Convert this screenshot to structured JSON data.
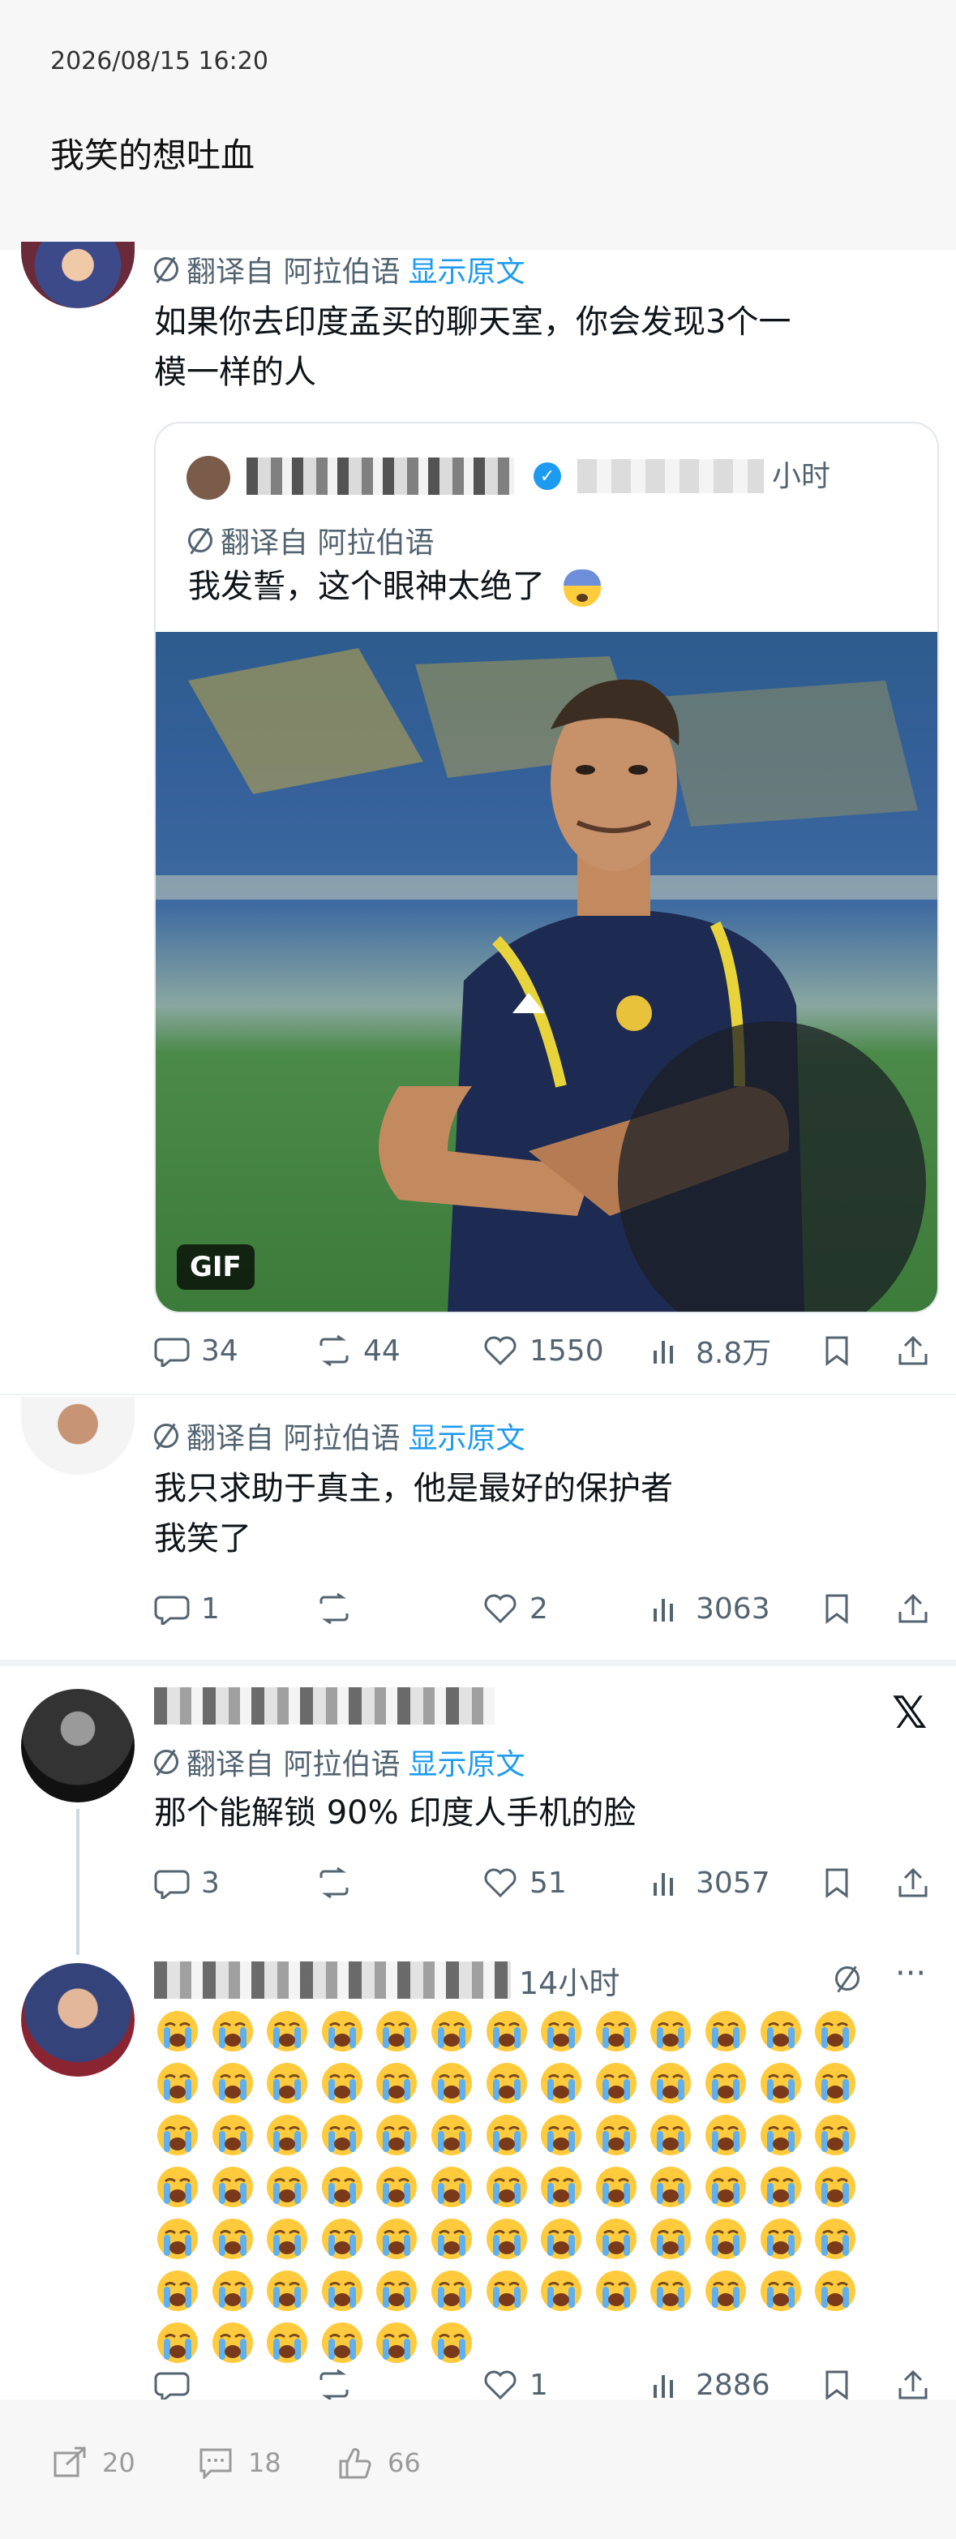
{
  "post": {
    "timestamp": "2026/08/15 16:20",
    "text": "我笑的想吐血"
  },
  "tweet1": {
    "translate_label": "翻译自 阿拉伯语",
    "show_original": "显示原文",
    "text_line1": "如果你去印度孟买的聊天室，你会发现3个一",
    "text_line2": "模一样的人",
    "quote": {
      "time": "小时",
      "translate_label": "翻译自 阿拉伯语",
      "text": "我发誓，这个眼神太绝了",
      "gif_label": "GIF"
    },
    "replies": "34",
    "retweets": "44",
    "likes": "1550",
    "views": "8.8万"
  },
  "tweet2": {
    "translate_label": "翻译自 阿拉伯语",
    "show_original": "显示原文",
    "text_line1": "我只求助于真主，他是最好的保护者",
    "text_line2": "我笑了",
    "replies": "1",
    "likes": "2",
    "views": "3063"
  },
  "tweet3": {
    "translate_label": "翻译自 阿拉伯语",
    "show_original": "显示原文",
    "text": "那个能解锁 90% 印度人手机的脸",
    "replies": "3",
    "likes": "51",
    "views": "3057"
  },
  "tweet4": {
    "time": "14小时",
    "emoji_count": 84,
    "likes": "1",
    "views": "2886"
  },
  "bottom_bar": {
    "share_count": "20",
    "comment_count": "18",
    "like_count": "66"
  },
  "icons": {
    "reply": "speech-bubble-icon",
    "retweet": "retweet-icon",
    "like": "heart-icon",
    "views": "bar-chart-icon",
    "bookmark": "bookmark-icon",
    "share": "share-icon",
    "translate": "globe-slash-icon",
    "x": "x-logo-icon"
  },
  "colors": {
    "accent": "#1d9bf0",
    "muted": "#536471"
  }
}
